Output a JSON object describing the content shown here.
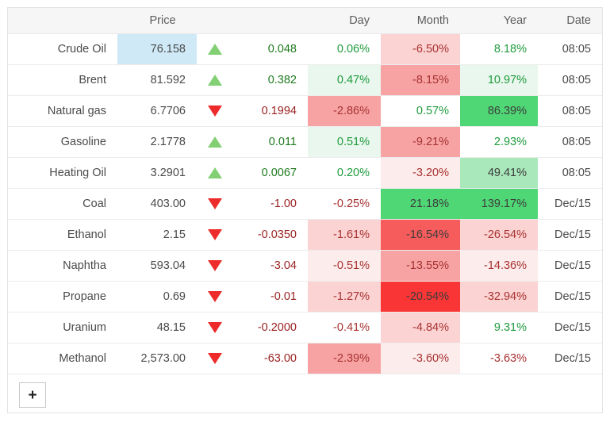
{
  "table": {
    "headers": {
      "name": "",
      "price": "Price",
      "arrow": "",
      "change": "",
      "day": "Day",
      "month": "Month",
      "year": "Year",
      "date": "Date"
    },
    "rows": [
      {
        "name": "Crude Oil",
        "price": "76.158",
        "price_highlight": true,
        "direction": "up",
        "change": "0.048",
        "day": "0.06%",
        "day_bg": "none",
        "month": "-6.50%",
        "month_bg": "red-2",
        "year": "8.18%",
        "year_bg": "none",
        "date": "08:05"
      },
      {
        "name": "Brent",
        "price": "81.592",
        "price_highlight": false,
        "direction": "up",
        "change": "0.382",
        "day": "0.47%",
        "day_bg": "green-1",
        "month": "-8.15%",
        "month_bg": "red-3",
        "year": "10.97%",
        "year_bg": "green-1",
        "date": "08:05"
      },
      {
        "name": "Natural gas",
        "price": "6.7706",
        "price_highlight": false,
        "direction": "down",
        "change": "0.1994",
        "day": "-2.86%",
        "day_bg": "red-3",
        "month": "0.57%",
        "month_bg": "none",
        "year": "86.39%",
        "year_bg": "green-4",
        "date": "08:05"
      },
      {
        "name": "Gasoline",
        "price": "2.1778",
        "price_highlight": false,
        "direction": "up",
        "change": "0.011",
        "day": "0.51%",
        "day_bg": "green-1",
        "month": "-9.21%",
        "month_bg": "red-3",
        "year": "2.93%",
        "year_bg": "none",
        "date": "08:05"
      },
      {
        "name": "Heating Oil",
        "price": "3.2901",
        "price_highlight": false,
        "direction": "up",
        "change": "0.0067",
        "day": "0.20%",
        "day_bg": "none",
        "month": "-3.20%",
        "month_bg": "red-1",
        "year": "49.41%",
        "year_bg": "green-3",
        "date": "08:05"
      },
      {
        "name": "Coal",
        "price": "403.00",
        "price_highlight": false,
        "direction": "down",
        "change": "-1.00",
        "day": "-0.25%",
        "day_bg": "none",
        "month": "21.18%",
        "month_bg": "green-4",
        "year": "139.17%",
        "year_bg": "green-4",
        "date": "Dec/15"
      },
      {
        "name": "Ethanol",
        "price": "2.15",
        "price_highlight": false,
        "direction": "down",
        "change": "-0.0350",
        "day": "-1.61%",
        "day_bg": "red-2",
        "month": "-16.54%",
        "month_bg": "red-4",
        "year": "-26.54%",
        "year_bg": "red-2",
        "date": "Dec/15"
      },
      {
        "name": "Naphtha",
        "price": "593.04",
        "price_highlight": false,
        "direction": "down",
        "change": "-3.04",
        "day": "-0.51%",
        "day_bg": "red-1",
        "month": "-13.55%",
        "month_bg": "red-3",
        "year": "-14.36%",
        "year_bg": "red-1",
        "date": "Dec/15"
      },
      {
        "name": "Propane",
        "price": "0.69",
        "price_highlight": false,
        "direction": "down",
        "change": "-0.01",
        "day": "-1.27%",
        "day_bg": "red-2",
        "month": "-20.54%",
        "month_bg": "red-5",
        "year": "-32.94%",
        "year_bg": "red-2",
        "date": "Dec/15"
      },
      {
        "name": "Uranium",
        "price": "48.15",
        "price_highlight": false,
        "direction": "down",
        "change": "-0.2000",
        "day": "-0.41%",
        "day_bg": "none",
        "month": "-4.84%",
        "month_bg": "red-2",
        "year": "9.31%",
        "year_bg": "none",
        "date": "Dec/15"
      },
      {
        "name": "Methanol",
        "price": "2,573.00",
        "price_highlight": false,
        "direction": "down",
        "change": "-63.00",
        "day": "-2.39%",
        "day_bg": "red-3",
        "month": "-3.60%",
        "month_bg": "red-1",
        "year": "-3.63%",
        "year_bg": "none",
        "date": "Dec/15"
      }
    ]
  },
  "footer": {
    "add_label": "+"
  },
  "colors": {
    "highlight_price": "#cfe9f7",
    "up_arrow": "#82cf74",
    "down_arrow": "#ee2b2b",
    "positive_text": "#1f9b3d",
    "negative_text": "#a83232",
    "header_bg": "#f6f6f6",
    "border": "#ececec",
    "red-1": "#fceceb",
    "red-2": "#fbd3d2",
    "red-3": "#f7a3a3",
    "red-4": "#f75c5c",
    "red-5": "#fa3535",
    "green-1": "#eaf7ee",
    "green-3": "#a8e8ba",
    "green-4": "#4fd675"
  }
}
